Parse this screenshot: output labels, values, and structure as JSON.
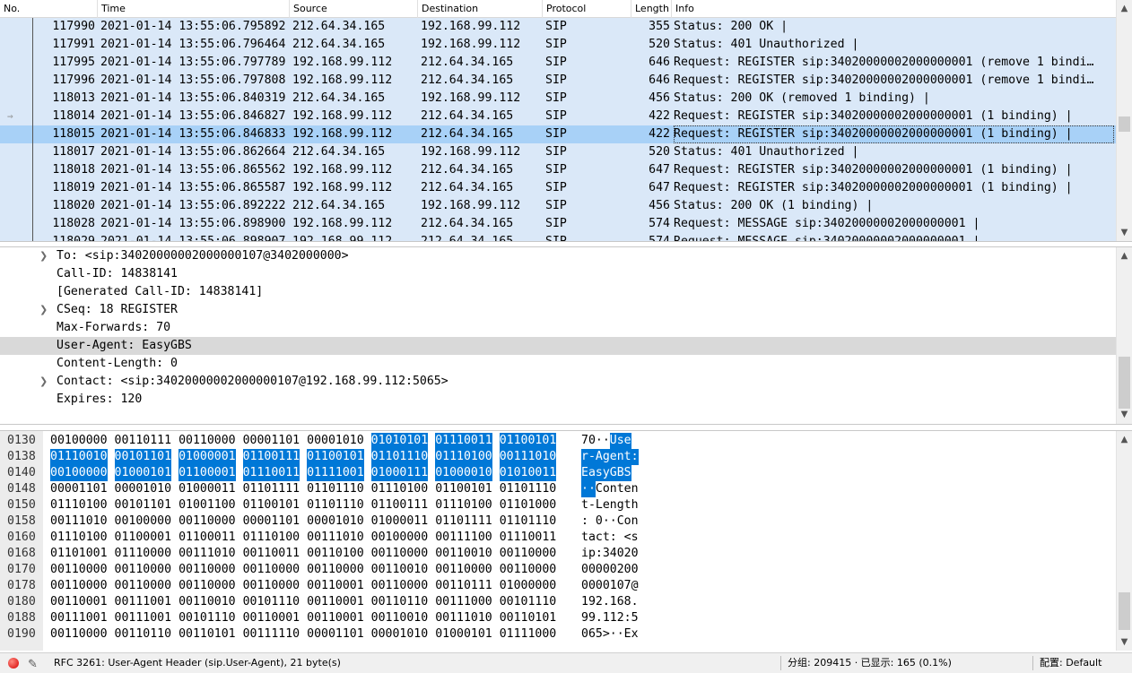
{
  "packet_list": {
    "columns": [
      "No.",
      "Time",
      "Source",
      "Destination",
      "Protocol",
      "Length",
      "Info"
    ],
    "rows": [
      {
        "no": "117990",
        "time": "2021-01-14 13:55:06.795892",
        "src": "212.64.34.165",
        "dst": "192.168.99.112",
        "proto": "SIP",
        "len": "355",
        "info": "Status: 200 OK |"
      },
      {
        "no": "117991",
        "time": "2021-01-14 13:55:06.796464",
        "src": "212.64.34.165",
        "dst": "192.168.99.112",
        "proto": "SIP",
        "len": "520",
        "info": "Status: 401 Unauthorized |"
      },
      {
        "no": "117995",
        "time": "2021-01-14 13:55:06.797789",
        "src": "192.168.99.112",
        "dst": "212.64.34.165",
        "proto": "SIP",
        "len": "646",
        "info": "Request: REGISTER sip:34020000002000000001  (remove 1 bindi…"
      },
      {
        "no": "117996",
        "time": "2021-01-14 13:55:06.797808",
        "src": "192.168.99.112",
        "dst": "212.64.34.165",
        "proto": "SIP",
        "len": "646",
        "info": "Request: REGISTER sip:34020000002000000001  (remove 1 bindi…"
      },
      {
        "no": "118013",
        "time": "2021-01-14 13:55:06.840319",
        "src": "212.64.34.165",
        "dst": "192.168.99.112",
        "proto": "SIP",
        "len": "456",
        "info": "Status: 200 OK  (removed 1 binding) |"
      },
      {
        "no": "118014",
        "time": "2021-01-14 13:55:06.846827",
        "src": "192.168.99.112",
        "dst": "212.64.34.165",
        "proto": "SIP",
        "len": "422",
        "info": "Request: REGISTER sip:34020000002000000001  (1 binding) |"
      },
      {
        "no": "118015",
        "time": "2021-01-14 13:55:06.846833",
        "src": "192.168.99.112",
        "dst": "212.64.34.165",
        "proto": "SIP",
        "len": "422",
        "info": "Request: REGISTER sip:34020000002000000001  (1 binding) |"
      },
      {
        "no": "118017",
        "time": "2021-01-14 13:55:06.862664",
        "src": "212.64.34.165",
        "dst": "192.168.99.112",
        "proto": "SIP",
        "len": "520",
        "info": "Status: 401 Unauthorized |"
      },
      {
        "no": "118018",
        "time": "2021-01-14 13:55:06.865562",
        "src": "192.168.99.112",
        "dst": "212.64.34.165",
        "proto": "SIP",
        "len": "647",
        "info": "Request: REGISTER sip:34020000002000000001  (1 binding) |"
      },
      {
        "no": "118019",
        "time": "2021-01-14 13:55:06.865587",
        "src": "192.168.99.112",
        "dst": "212.64.34.165",
        "proto": "SIP",
        "len": "647",
        "info": "Request: REGISTER sip:34020000002000000001  (1 binding) |"
      },
      {
        "no": "118020",
        "time": "2021-01-14 13:55:06.892222",
        "src": "212.64.34.165",
        "dst": "192.168.99.112",
        "proto": "SIP",
        "len": "456",
        "info": "Status: 200 OK  (1 binding) |"
      },
      {
        "no": "118028",
        "time": "2021-01-14 13:55:06.898900",
        "src": "192.168.99.112",
        "dst": "212.64.34.165",
        "proto": "SIP",
        "len": "574",
        "info": "Request: MESSAGE sip:34020000002000000001 |"
      },
      {
        "no": "118029",
        "time": "2021-01-14 13:55:06.898907",
        "src": "192.168.99.112",
        "dst": "212.64.34.165",
        "proto": "SIP",
        "len": "574",
        "info": "Request: MESSAGE sip:34020000002000000001 |"
      }
    ],
    "selected_no": "118015",
    "related_no": "118014"
  },
  "details": {
    "rows": [
      {
        "expandable": true,
        "text": "To: <sip:34020000002000000107@3402000000>"
      },
      {
        "expandable": false,
        "text": "Call-ID: 14838141"
      },
      {
        "expandable": false,
        "text": "[Generated Call-ID: 14838141]"
      },
      {
        "expandable": true,
        "text": "CSeq: 18 REGISTER"
      },
      {
        "expandable": false,
        "text": "Max-Forwards: 70"
      },
      {
        "expandable": false,
        "text": "User-Agent: EasyGBS",
        "highlighted": true
      },
      {
        "expandable": false,
        "text": "Content-Length: 0"
      },
      {
        "expandable": true,
        "text": "Contact: <sip:34020000002000000107@192.168.99.112:5065>"
      },
      {
        "expandable": false,
        "text": "Expires: 120"
      }
    ]
  },
  "bytes": {
    "rows": [
      {
        "offset": "0130",
        "bits": [
          "00100000",
          "00110111",
          "00110000",
          "00001101",
          "00001010",
          "01010101",
          "01110011",
          "01100101"
        ],
        "ascii": [
          " 70··",
          "Use"
        ],
        "sel_from": 5
      },
      {
        "offset": "0138",
        "bits": [
          "01110010",
          "00101101",
          "01000001",
          "01100111",
          "01100101",
          "01101110",
          "01110100",
          "00111010"
        ],
        "ascii": [
          "",
          "r-Agent:"
        ],
        "sel_from": 0
      },
      {
        "offset": "0140",
        "bits": [
          "00100000",
          "01000101",
          "01100001",
          "01110011",
          "01111001",
          "01000111",
          "01000010",
          "01010011"
        ],
        "ascii": [
          "",
          " EasyGBS"
        ],
        "sel_from": 0
      },
      {
        "offset": "0148",
        "bits": [
          "00001101",
          "00001010",
          "01000011",
          "01101111",
          "01101110",
          "01110100",
          "01100101",
          "01101110"
        ],
        "ascii": [
          "··",
          "Conten"
        ],
        "sel_to": 2
      },
      {
        "offset": "0150",
        "bits": [
          "01110100",
          "00101101",
          "01001100",
          "01100101",
          "01101110",
          "01100111",
          "01110100",
          "01101000"
        ],
        "ascii": [
          "t-Length",
          ""
        ]
      },
      {
        "offset": "0158",
        "bits": [
          "00111010",
          "00100000",
          "00110000",
          "00001101",
          "00001010",
          "01000011",
          "01101111",
          "01101110"
        ],
        "ascii": [
          ": 0··Con",
          ""
        ]
      },
      {
        "offset": "0160",
        "bits": [
          "01110100",
          "01100001",
          "01100011",
          "01110100",
          "00111010",
          "00100000",
          "00111100",
          "01110011"
        ],
        "ascii": [
          "tact: <s",
          ""
        ]
      },
      {
        "offset": "0168",
        "bits": [
          "01101001",
          "01110000",
          "00111010",
          "00110011",
          "00110100",
          "00110000",
          "00110010",
          "00110000"
        ],
        "ascii": [
          "ip:34020",
          ""
        ]
      },
      {
        "offset": "0170",
        "bits": [
          "00110000",
          "00110000",
          "00110000",
          "00110000",
          "00110000",
          "00110010",
          "00110000",
          "00110000"
        ],
        "ascii": [
          "00000200",
          ""
        ]
      },
      {
        "offset": "0178",
        "bits": [
          "00110000",
          "00110000",
          "00110000",
          "00110000",
          "00110001",
          "00110000",
          "00110111",
          "01000000"
        ],
        "ascii": [
          "0000107@",
          ""
        ]
      },
      {
        "offset": "0180",
        "bits": [
          "00110001",
          "00111001",
          "00110010",
          "00101110",
          "00110001",
          "00110110",
          "00111000",
          "00101110"
        ],
        "ascii": [
          "192.168.",
          ""
        ]
      },
      {
        "offset": "0188",
        "bits": [
          "00111001",
          "00111001",
          "00101110",
          "00110001",
          "00110001",
          "00110010",
          "00111010",
          "00110101"
        ],
        "ascii": [
          "99.112:5",
          ""
        ]
      },
      {
        "offset": "0190",
        "bits": [
          "00110000",
          "00110110",
          "00110101",
          "00111110",
          "00001101",
          "00001010",
          "01000101",
          "01111000"
        ],
        "ascii": [
          "065>··Ex",
          ""
        ]
      }
    ]
  },
  "status_bar": {
    "field_info": "RFC 3261: User-Agent Header (sip.User-Agent), 21 byte(s)",
    "packets": "分组: 209415 · 已显示: 165 (0.1%)",
    "profile": "配置: Default"
  },
  "icons": {
    "expand": "chevron-right-icon",
    "scroll_up": "scroll-up-icon",
    "scroll_down": "scroll-down-icon",
    "expert": "expert-info-icon",
    "edit": "pencil-icon"
  },
  "colors": {
    "row_bg": "#dae8f8",
    "selected_row": "#a8d1f7",
    "byte_selection": "#0078d7",
    "detail_highlight": "#d9d9d9",
    "expert_red": "#d50000"
  }
}
